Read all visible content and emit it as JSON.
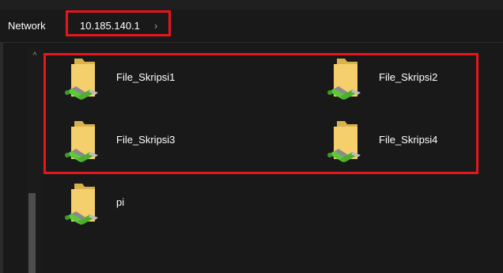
{
  "breadcrumb": {
    "items": [
      {
        "label": "Network"
      },
      {
        "label": "10.185.140.1"
      }
    ],
    "separator": "›"
  },
  "scrollbar": {
    "up_arrow": "^"
  },
  "folders": [
    {
      "label": "File_Skripsi1",
      "icon": "network-folder-icon"
    },
    {
      "label": "File_Skripsi2",
      "icon": "network-folder-icon"
    },
    {
      "label": "File_Skripsi3",
      "icon": "network-folder-icon"
    },
    {
      "label": "File_Skripsi4",
      "icon": "network-folder-icon"
    },
    {
      "label": "pi",
      "icon": "network-folder-icon"
    }
  ],
  "colors": {
    "background": "#191919",
    "highlight": "#e8161c",
    "folder": "#f4cf6b",
    "cable": "#5cc93a",
    "text": "#ffffff"
  }
}
